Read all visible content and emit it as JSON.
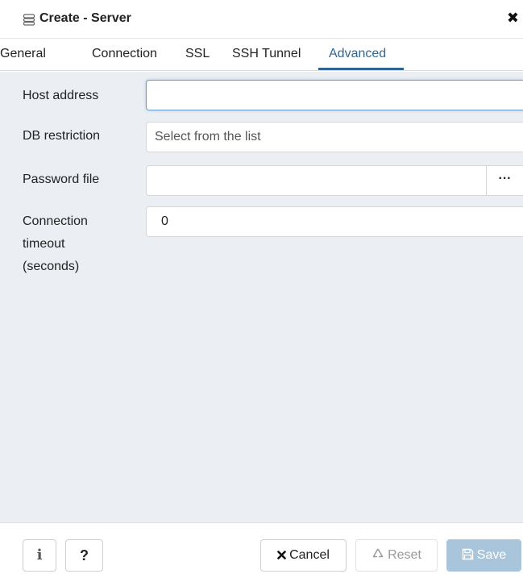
{
  "title": {
    "text": "Create - Server",
    "icon": "server-icon",
    "close_glyph": "✖"
  },
  "tabs": [
    {
      "label": "General",
      "active": false
    },
    {
      "label": "Connection",
      "active": false
    },
    {
      "label": "SSL",
      "active": false
    },
    {
      "label": "SSH Tunnel",
      "active": false
    },
    {
      "label": "Advanced",
      "active": true
    }
  ],
  "fields": {
    "host_address": {
      "label": "Host address",
      "value": ""
    },
    "db_restriction": {
      "label": "DB restriction",
      "placeholder": "Select from the list"
    },
    "password_file": {
      "label": "Password file",
      "value": "",
      "browse_label": "···"
    },
    "connection_timeout": {
      "label_lines": [
        "Connection",
        "timeout",
        "(seconds)"
      ],
      "value": "0"
    }
  },
  "footer": {
    "info_label": "i",
    "help_label": "?",
    "cancel_label": "Cancel",
    "reset_label": "Reset",
    "save_label": "Save"
  },
  "colors": {
    "accent": "#326690",
    "content_bg": "#ebeef3",
    "save_disabled": "#a9c5db"
  }
}
